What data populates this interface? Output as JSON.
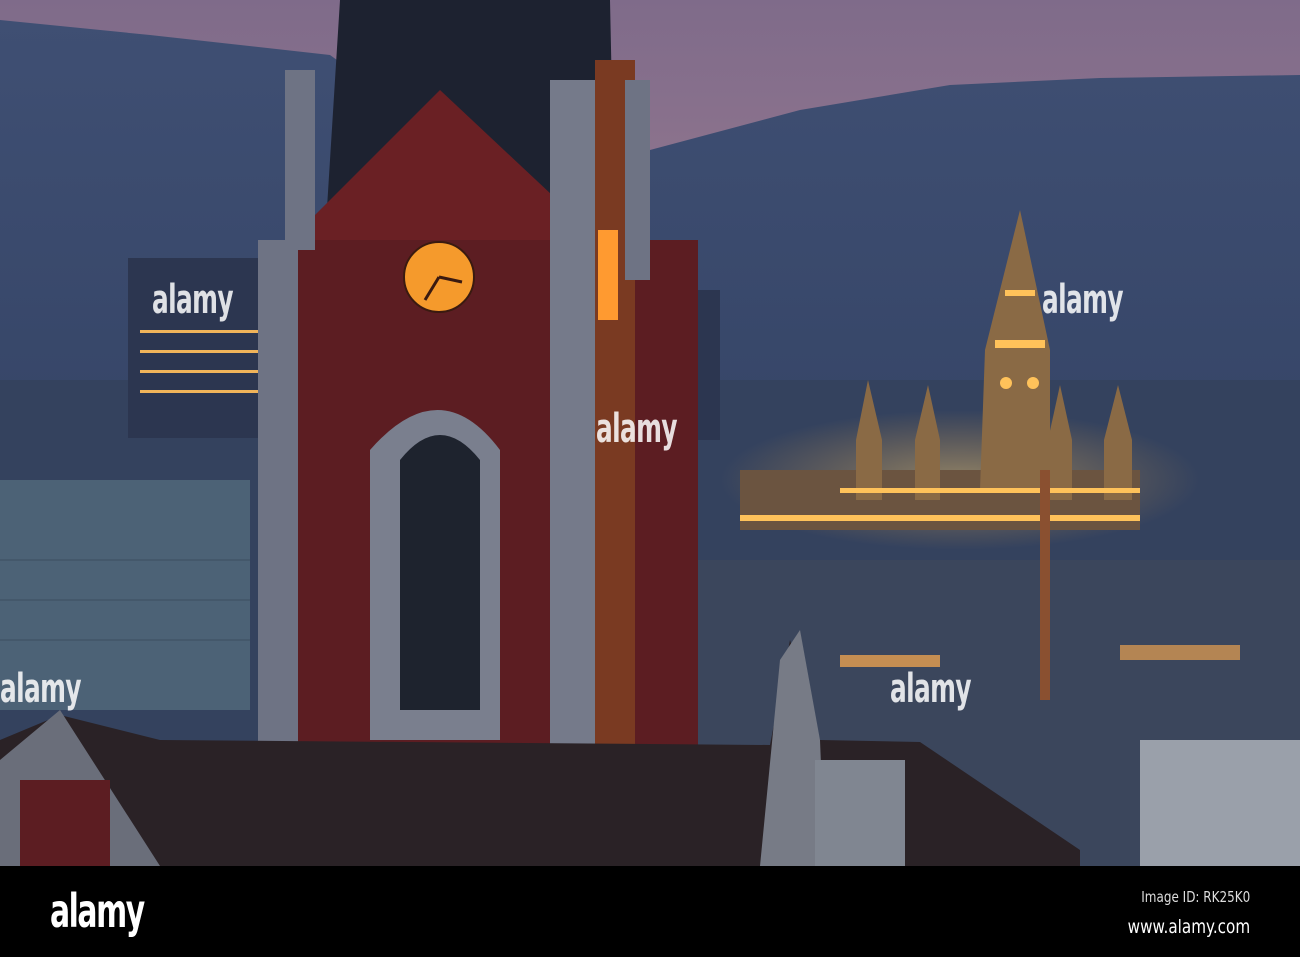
{
  "watermark": {
    "text": "alamy"
  },
  "footer": {
    "logo": "alamy",
    "image_id": "Image ID: RK25K0",
    "website": "www.alamy.com"
  },
  "colors": {
    "sky_top": "#8b6f88",
    "sky_low": "#c08e94",
    "mountain": "#3e4f72",
    "brick": "#5c1d22",
    "clock": "#f59a2c",
    "lights": "#ffc25a"
  }
}
